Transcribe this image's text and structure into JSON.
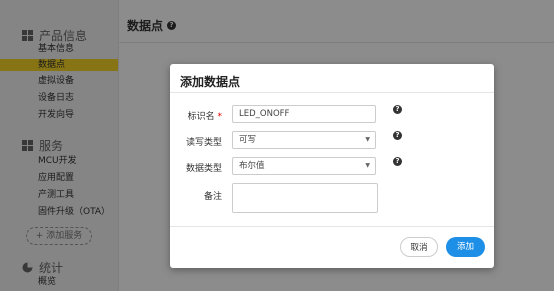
{
  "sidebar": {
    "sections": [
      {
        "title": "产品信息",
        "icon": "product-grid-icon",
        "items": [
          {
            "label": "基本信息",
            "active": false
          },
          {
            "label": "数据点",
            "active": true
          },
          {
            "label": "虚拟设备",
            "active": false
          },
          {
            "label": "设备日志",
            "active": false
          },
          {
            "label": "开发向导",
            "active": false
          }
        ]
      },
      {
        "title": "服务",
        "icon": "services-grid-icon",
        "items": [
          {
            "label": "MCU开发"
          },
          {
            "label": "应用配置"
          },
          {
            "label": "产测工具"
          },
          {
            "label": "固件升级（OTA）"
          }
        ],
        "add_label": "+ 添加服务"
      },
      {
        "title": "统计",
        "icon": "stats-icon",
        "items": [
          {
            "label": "概览"
          }
        ]
      }
    ]
  },
  "main": {
    "title": "数据点",
    "help_icon": "question-icon"
  },
  "modal": {
    "title": "添加数据点",
    "fields": {
      "identifier": {
        "label": "标识名",
        "required_mark": "*",
        "value": "LED_ONOFF"
      },
      "rw_type": {
        "label": "读写类型",
        "value": "可写"
      },
      "data_type": {
        "label": "数据类型",
        "value": "布尔值"
      },
      "remark": {
        "label": "备注",
        "value": ""
      }
    },
    "buttons": {
      "cancel": "取消",
      "add": "添加"
    }
  },
  "colors": {
    "active_nav": "#f5d327",
    "primary": "#1d8fe6"
  }
}
